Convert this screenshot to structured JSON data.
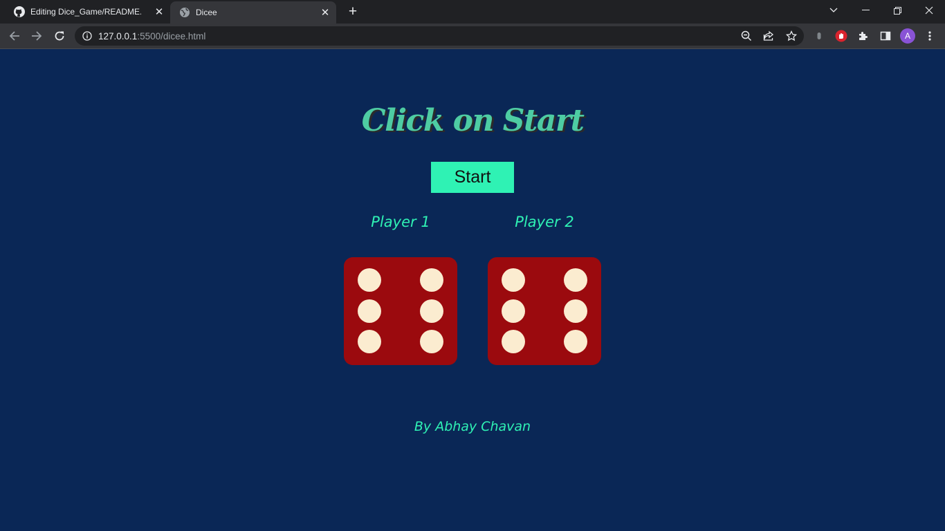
{
  "browser": {
    "tabs": [
      {
        "title": "Editing Dice_Game/README.md",
        "icon": "github-icon",
        "active": false
      },
      {
        "title": "Dicee",
        "icon": "globe-icon",
        "active": true
      }
    ],
    "url_host": "127.0.0.1",
    "url_rest": ":5500/dicee.html",
    "profile_initial": "A",
    "colors": {
      "tabstrip": "#202124",
      "toolbar": "#35363a",
      "omnibox": "#202124"
    }
  },
  "page": {
    "heading": "Click on Start",
    "start_button": "Start",
    "players": [
      {
        "label": "Player 1",
        "die_value": 6
      },
      {
        "label": "Player 2",
        "die_value": 6
      }
    ],
    "credit": "By Abhay Chavan",
    "colors": {
      "background": "#0a2756",
      "accent": "#2ff2b4",
      "heading": "#4ecca3",
      "die": "#9b0a0e",
      "pip": "#fbecd0"
    }
  }
}
